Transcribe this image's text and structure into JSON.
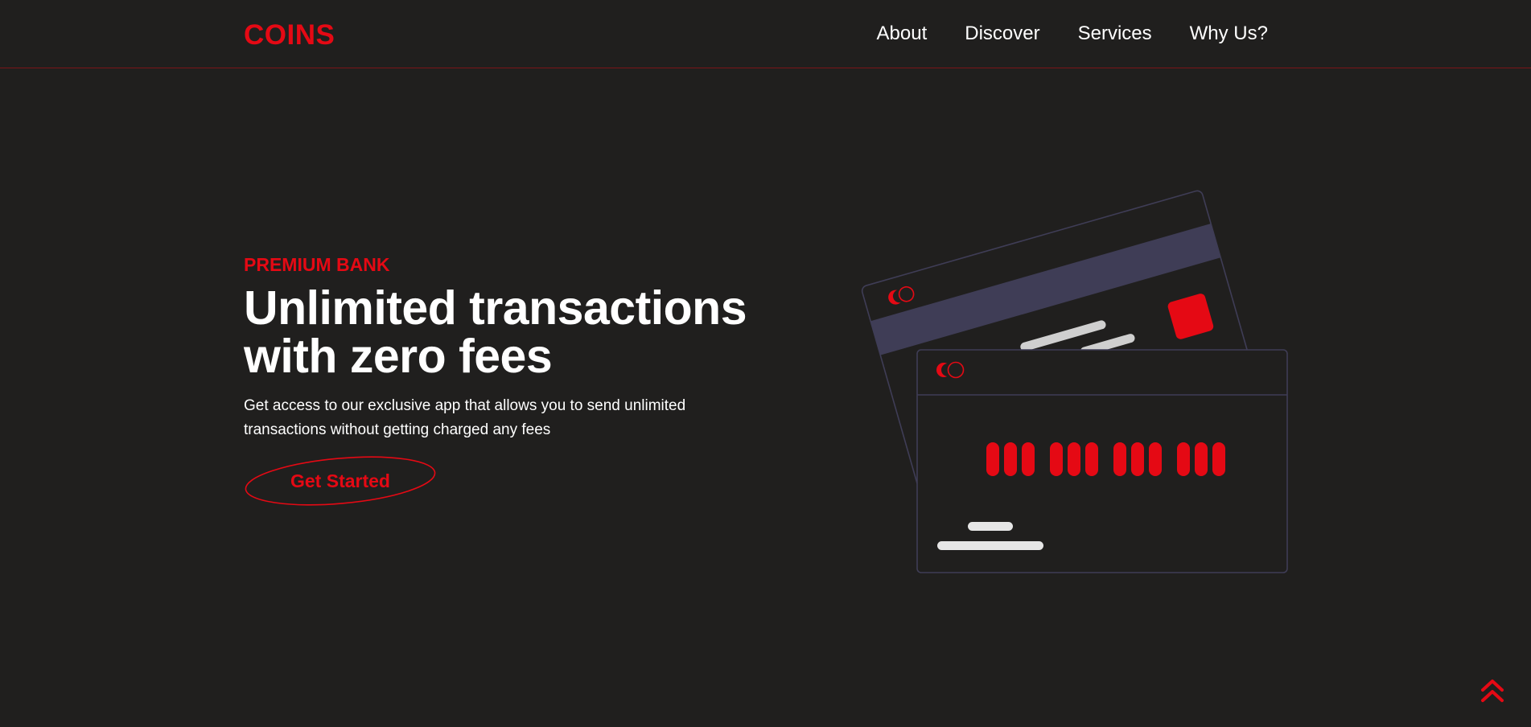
{
  "brand": {
    "name": "COINS",
    "accent_color": "#e50914",
    "background_color": "#201f1e",
    "card_stroke_color": "#3f3d56"
  },
  "nav": {
    "items": [
      {
        "label": "About"
      },
      {
        "label": "Discover"
      },
      {
        "label": "Services"
      },
      {
        "label": "Why Us?"
      }
    ]
  },
  "hero": {
    "eyebrow": "PREMIUM BANK",
    "headline_line1": "Unlimited transactions",
    "headline_line2": "with zero fees",
    "description": "Get access to our exclusive app that allows you to send unlimited transactions without getting charged any fees",
    "cta_label": "Get Started"
  },
  "icons": {
    "scroll_top": "double-chevron-up-icon",
    "card_logo": "coins-logo-icon",
    "card_chip": "chip-icon"
  }
}
